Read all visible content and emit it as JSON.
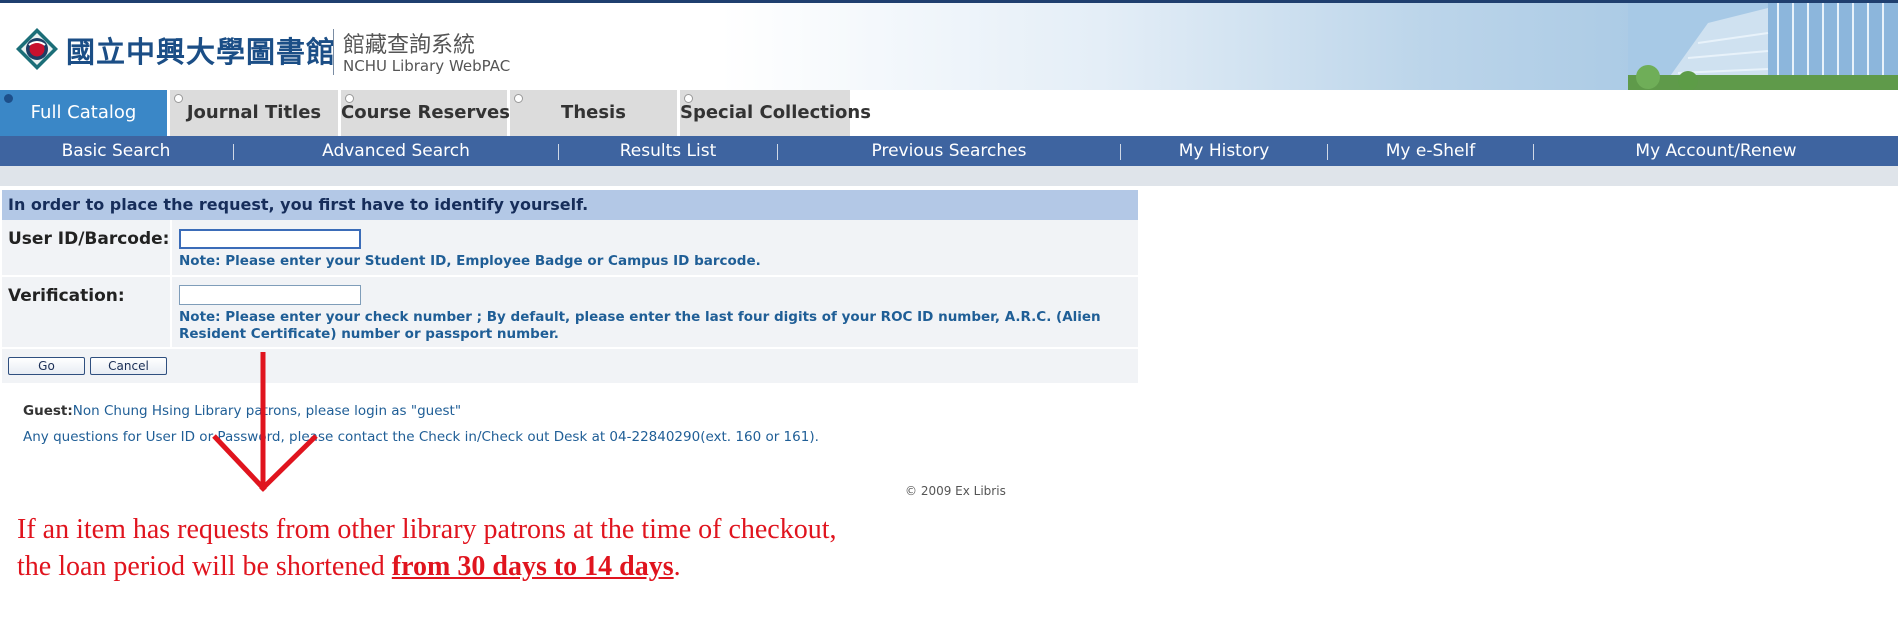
{
  "header": {
    "library_name": "國立中興大學圖書館",
    "system_name_cn": "館藏查詢系統",
    "system_name_en": "NCHU Library WebPAC"
  },
  "tabs": [
    {
      "label": "Full Catalog",
      "active": true
    },
    {
      "label": "Journal Titles",
      "active": false
    },
    {
      "label": "Course Reserves",
      "active": false
    },
    {
      "label": "Thesis",
      "active": false
    },
    {
      "label": "Special Collections",
      "active": false
    }
  ],
  "subnav": [
    "Basic Search",
    "Advanced Search",
    "Results List",
    "Previous Searches",
    "My History",
    "My e-Shelf",
    "My Account/Renew"
  ],
  "form": {
    "heading": "In order to place the request, you first have to identify yourself.",
    "user_id_label": "User ID/Barcode:",
    "user_id_value": "",
    "user_id_note": "Note: Please enter your Student ID, Employee Badge or Campus ID barcode.",
    "verification_label": "Verification:",
    "verification_value": "",
    "verification_note": "Note: Please enter your check number ; By default, please enter the last four digits of your ROC ID number, A.R.C. (Alien Resident Certificate) number or passport number.",
    "go_label": "Go",
    "cancel_label": "Cancel"
  },
  "info": {
    "guest_label": "Guest:",
    "guest_text": "Non Chung Hsing Library patrons, please login as \"guest\"",
    "questions": "Any questions for User ID or Password, please contact the Check in/Check out Desk at 04-22840290(ext. 160 or 161)."
  },
  "copyright": "© 2009 Ex Libris",
  "annotation": {
    "line1": "If an item has requests from other library patrons at the time of checkout,",
    "line2_prefix": "the loan period will be shortened ",
    "line2_emphasis": "from 30 days to 14 days",
    "line2_suffix": "."
  },
  "colors": {
    "tab_active": "#3a87c7",
    "subnav_bg": "#3e64a0",
    "form_header": "#b3c8e6",
    "note_text": "#1f5e96",
    "annotation_red": "#e0141e"
  },
  "icons": [
    "nchu-emblem-icon",
    "tab-marker-icon",
    "down-arrow-icon"
  ]
}
